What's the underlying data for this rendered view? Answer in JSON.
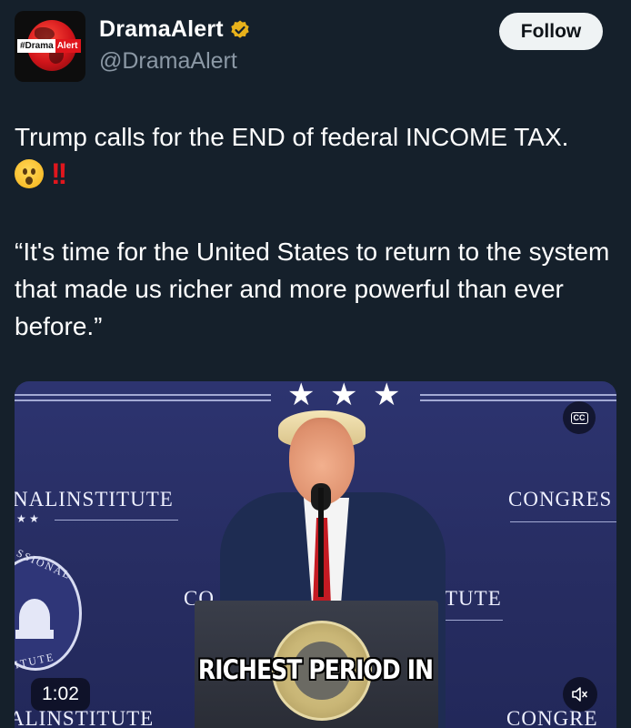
{
  "author": {
    "display_name": "DramaAlert",
    "handle": "@DramaAlert",
    "avatar_tag_part1": "#Drama",
    "avatar_tag_part2": "Alert"
  },
  "follow_label": "Follow",
  "tweet": {
    "text": "Trump calls for the END of federal INCOME TAX.",
    "emojis": [
      "hushed-face",
      "double-exclamation"
    ],
    "quote": "“It's time for the United States to return to the system that made us richer and more powerful than ever before.”"
  },
  "video": {
    "caption": "RICHEST PERIOD IN",
    "duration": "1:02",
    "cc_label": "CC",
    "background_text": {
      "left_upper": "NALINSTITUTE",
      "right_upper": "CONGRES",
      "center_left": "CO",
      "center_right": "TUTE",
      "left_lower": "ALINSTITUTE",
      "right_lower": "CONGRE",
      "seal_top": "SSIONAL",
      "seal_bottom": "ITUTE"
    }
  },
  "colors": {
    "background": "#15202b",
    "verified": "#e8b21b",
    "follow_bg": "#eff3f4",
    "secondary_text": "#8b98a5"
  }
}
